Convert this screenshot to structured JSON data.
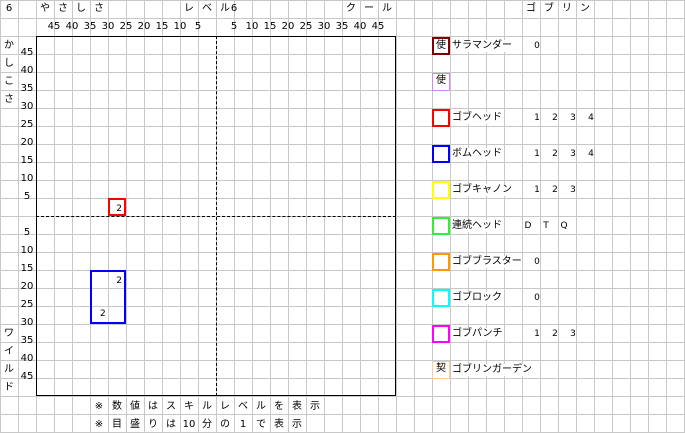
{
  "top_header": {
    "left_num": "6",
    "left_label": [
      "や",
      "さ",
      "し",
      "さ"
    ],
    "center_label": [
      "レ",
      "ベ",
      "ル"
    ],
    "center_num": "6",
    "right_label": [
      "ク",
      "ー",
      "ル"
    ],
    "gob_label": [
      "ゴ",
      "ブ",
      "リ",
      "ン"
    ]
  },
  "x_ticks_left": [
    "45",
    "40",
    "35",
    "30",
    "25",
    "20",
    "15",
    "10",
    "5"
  ],
  "x_ticks_right": [
    "5",
    "10",
    "15",
    "20",
    "25",
    "30",
    "35",
    "40",
    "45"
  ],
  "y_ticks_top": [
    "45",
    "40",
    "35",
    "30",
    "25",
    "20",
    "15",
    "10",
    "5"
  ],
  "y_ticks_bottom": [
    "5",
    "10",
    "15",
    "20",
    "25",
    "30",
    "35",
    "40",
    "45"
  ],
  "y_label_top": [
    "か",
    "し",
    "こ",
    "さ"
  ],
  "y_label_bottom": [
    "ワ",
    "イ",
    "ル",
    "ド"
  ],
  "notes": [
    "※",
    "数",
    "値",
    "は",
    "ス",
    "キ",
    "ル",
    "レ",
    "ベ",
    "ル",
    "を",
    "表",
    "示"
  ],
  "notes2": [
    "※",
    "目",
    "盛",
    "り",
    "は",
    "10",
    "分",
    "の",
    "1",
    "で",
    "表",
    "示"
  ],
  "plot_boxes": [
    {
      "name": "ゴブヘッド",
      "color": "#ff0000",
      "label": "2"
    },
    {
      "name": "ボムヘッド",
      "color": "#0000ff",
      "label_top": "2",
      "label_bottom": "2"
    }
  ],
  "legend": [
    {
      "icon_text": "使",
      "name": "サラマンダー",
      "color": "#800000",
      "levels": [
        "0"
      ]
    },
    {
      "icon_text": "使",
      "name": "",
      "color": "#cc88ff",
      "levels": []
    },
    {
      "icon_text": "",
      "name": "ゴブヘッド",
      "color": "#ff0000",
      "levels": [
        "1",
        "2",
        "3",
        "4"
      ]
    },
    {
      "icon_text": "",
      "name": "ボムヘッド",
      "color": "#0000ff",
      "levels": [
        "1",
        "2",
        "3",
        "4"
      ]
    },
    {
      "icon_text": "",
      "name": "ゴブキャノン",
      "color": "#ffff00",
      "levels": [
        "1",
        "2",
        "3"
      ]
    },
    {
      "icon_text": "",
      "name": "連続ヘッド",
      "color": "#33ee33",
      "levels": [
        "D",
        "T",
        "Q"
      ]
    },
    {
      "icon_text": "",
      "name": "ゴブブラスター",
      "color": "#ff9900",
      "levels": [
        "0"
      ]
    },
    {
      "icon_text": "",
      "name": "ゴブロック",
      "color": "#00ffff",
      "levels": [
        "0"
      ]
    },
    {
      "icon_text": "",
      "name": "ゴブパンチ",
      "color": "#ff00ff",
      "levels": [
        "1",
        "2",
        "3"
      ]
    },
    {
      "icon_text": "契",
      "name": "ゴブリンガーデン",
      "color": "#ffcc99",
      "levels": []
    }
  ]
}
